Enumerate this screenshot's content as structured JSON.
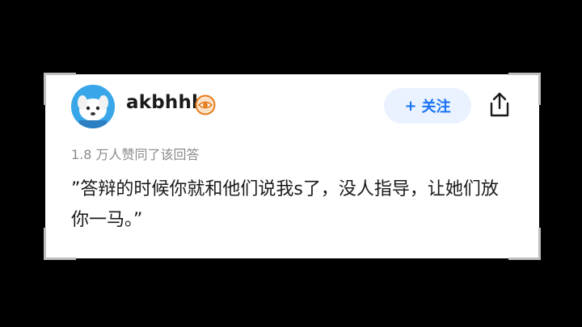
{
  "user": {
    "name": "akbhhh",
    "badge_icon": "eye-badge-icon",
    "avatar_icon": "dog-avatar-icon"
  },
  "actions": {
    "follow_plus": "+",
    "follow_label": "关注",
    "share_icon": "share-icon"
  },
  "answer": {
    "likes_text": "1.8 万人赞同了该回答",
    "text": "”答辩的时候你就和他们说我s了，没人指导，让她们放你一马。”"
  },
  "colors": {
    "accent": "#1772f6",
    "follow_bg": "#eaf2ff",
    "avatar_bg": "#38a6e8",
    "badge": "#e67e22"
  }
}
